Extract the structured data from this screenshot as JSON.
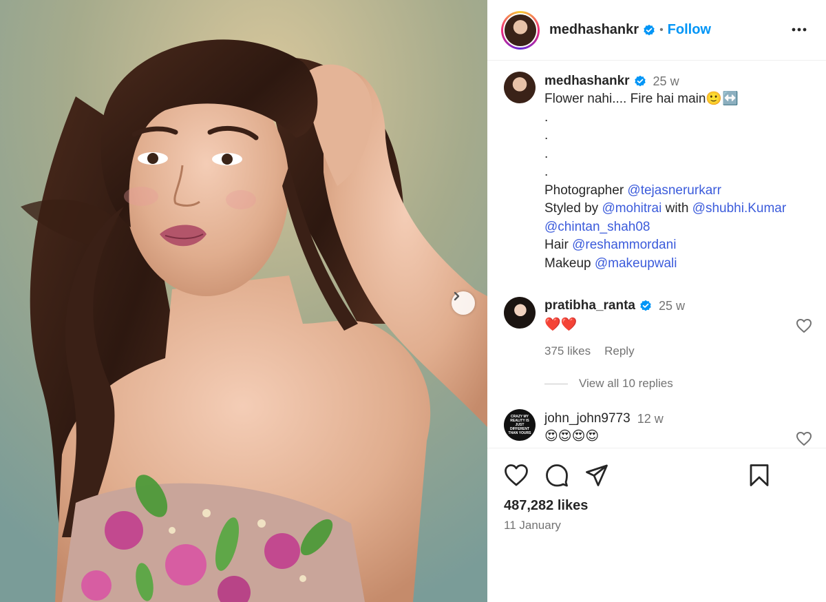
{
  "post": {
    "username": "medhashankr",
    "follow_label": "Follow",
    "dot": "•"
  },
  "caption": {
    "username": "medhashankr",
    "time": "25 w",
    "line1": "Flower nahi.... Fire hai main🙂↔️",
    "dots": [
      ".",
      ".",
      ".",
      "."
    ],
    "credits": [
      {
        "label": "Photographer ",
        "mentions": [
          "@tejasnerurkarr"
        ],
        "sep": []
      },
      {
        "label": "Styled by ",
        "mentions": [
          "@mohitrai",
          "@shubhi.Kumar"
        ],
        "sep": [
          " with "
        ]
      },
      {
        "label": "",
        "mentions": [
          "@chintan_shah08"
        ],
        "sep": []
      },
      {
        "label": "Hair ",
        "mentions": [
          "@reshammordani"
        ],
        "sep": []
      },
      {
        "label": "Makeup ",
        "mentions": [
          "@makeupwali"
        ],
        "sep": []
      }
    ]
  },
  "comments": [
    {
      "username": "pratibha_ranta",
      "time": "25 w",
      "text": "❤️❤️",
      "likes": "375 likes",
      "reply": "Reply",
      "view_replies": "View all 10 replies"
    },
    {
      "username": "john_john9773",
      "time": "12 w",
      "text": "😍😍😍😍",
      "avatar_text": "CRAZY MY REALITY IS JUST DIFFERENT THAN YOURS"
    }
  ],
  "footer": {
    "likes": "487,282 likes",
    "date": "11 January"
  },
  "icons": {
    "verified": "verified-badge-icon",
    "more": "more-options-icon",
    "next": "chevron-right-icon",
    "like": "heart-icon",
    "comment": "comment-bubble-icon",
    "share": "paper-plane-icon",
    "save": "bookmark-icon"
  },
  "colors": {
    "link": "#3b5bdb",
    "follow": "#0095f6",
    "verified": "#0095f6",
    "muted": "#737373"
  }
}
